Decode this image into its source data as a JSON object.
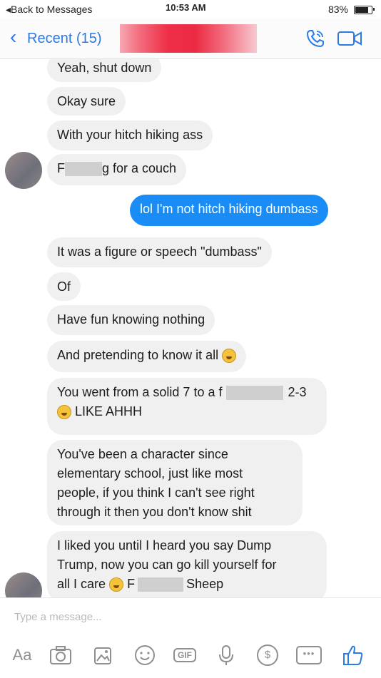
{
  "status_bar": {
    "back_label": "◂Back to Messages",
    "time": "10:53 AM",
    "battery": "83%"
  },
  "header": {
    "back_label": "Recent (15)"
  },
  "messages": [
    {
      "text": "Yeah, shut down",
      "dir": "in"
    },
    {
      "text": "Okay sure",
      "dir": "in"
    },
    {
      "text": "With your hitch hiking ass",
      "dir": "in"
    },
    {
      "text_before": "F",
      "text_after": "g for a couch",
      "dir": "in"
    },
    {
      "text": "lol I'm not hitch hiking dumbass",
      "dir": "out"
    },
    {
      "text": "It was a figure or speech \"dumbass\"",
      "dir": "in"
    },
    {
      "text": "Of",
      "dir": "in"
    },
    {
      "text": "Have fun knowing nothing",
      "dir": "in"
    },
    {
      "text": "And pretending to know it all",
      "dir": "in"
    },
    {
      "line1_before": "You went from a solid 7 to a f",
      "line1_after": "2-3",
      "line2": "LIKE AHHH",
      "dir": "in"
    },
    {
      "lines": [
        "You've been a character since",
        "elementary school, just like most",
        "people, if you think I can't see right",
        "through it then you don't know shit"
      ],
      "dir": "in"
    },
    {
      "lines": [
        "I liked you until I heard you say Dump",
        "Trump, now you can go kill yourself for"
      ],
      "line3_before": "all I care",
      "line3_mid": "F",
      "line3_after": "Sheep",
      "dir": "in"
    }
  ],
  "composer": {
    "placeholder": "Type a message...",
    "aa_label": "Aa",
    "gif_label": "GIF"
  },
  "icons": [
    "camera-icon",
    "image-icon",
    "emoji-icon",
    "gif-icon",
    "mic-icon",
    "payment-icon",
    "more-icon",
    "thumbs-up-icon",
    "phone-icon",
    "video-icon"
  ],
  "colors": {
    "accent": "#2b7be5",
    "outgoing_bubble": "#1a8cf6",
    "incoming_bubble": "#f0f0f0"
  }
}
